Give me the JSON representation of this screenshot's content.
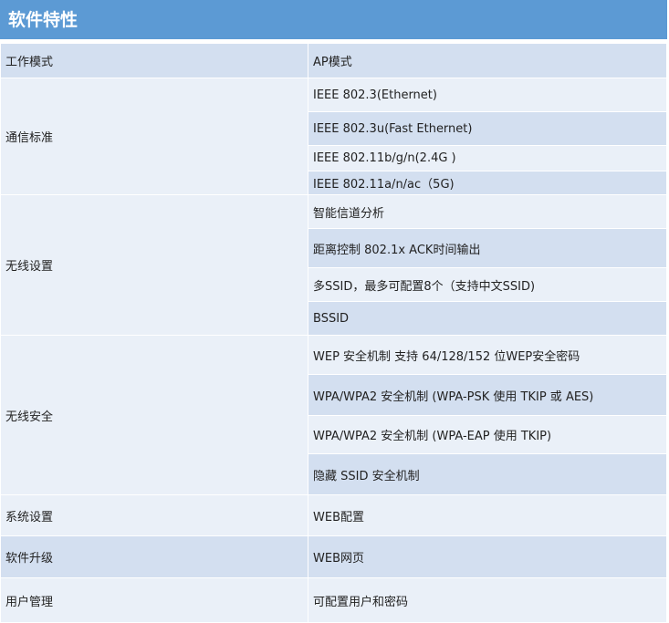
{
  "header": {
    "title": "软件特性"
  },
  "rows": {
    "work_mode": {
      "label": "工作模式",
      "values": [
        "AP模式"
      ]
    },
    "comm_standard": {
      "label": "通信标准",
      "values": [
        "IEEE 802.3(Ethernet)",
        "IEEE 802.3u(Fast Ethernet)",
        "IEEE 802.11b/g/n(2.4G )",
        "IEEE 802.11a/n/ac（5G)"
      ]
    },
    "wireless_settings": {
      "label": "无线设置",
      "values": [
        "智能信道分析",
        "距离控制 802.1x ACK时间输出",
        "多SSID，最多可配置8个（支持中文SSID)",
        "BSSID"
      ]
    },
    "wireless_security": {
      "label": "无线安全",
      "values": [
        "WEP 安全机制 支持 64/128/152 位WEP安全密码",
        "WPA/WPA2 安全机制 (WPA-PSK 使用 TKIP 或 AES)",
        "WPA/WPA2 安全机制 (WPA-EAP 使用 TKIP)",
        "隐藏 SSID  安全机制"
      ]
    },
    "system_settings": {
      "label": "系统设置",
      "values": [
        "WEB配置"
      ]
    },
    "software_upgrade": {
      "label": "软件升级",
      "values": [
        "WEB网页"
      ]
    },
    "user_management": {
      "label": "用户管理",
      "values": [
        "可配置用户和密码"
      ]
    }
  },
  "colors": {
    "header": "#5c9ad4",
    "row_dark": "#d3dff0",
    "row_light": "#eaf0f8"
  }
}
